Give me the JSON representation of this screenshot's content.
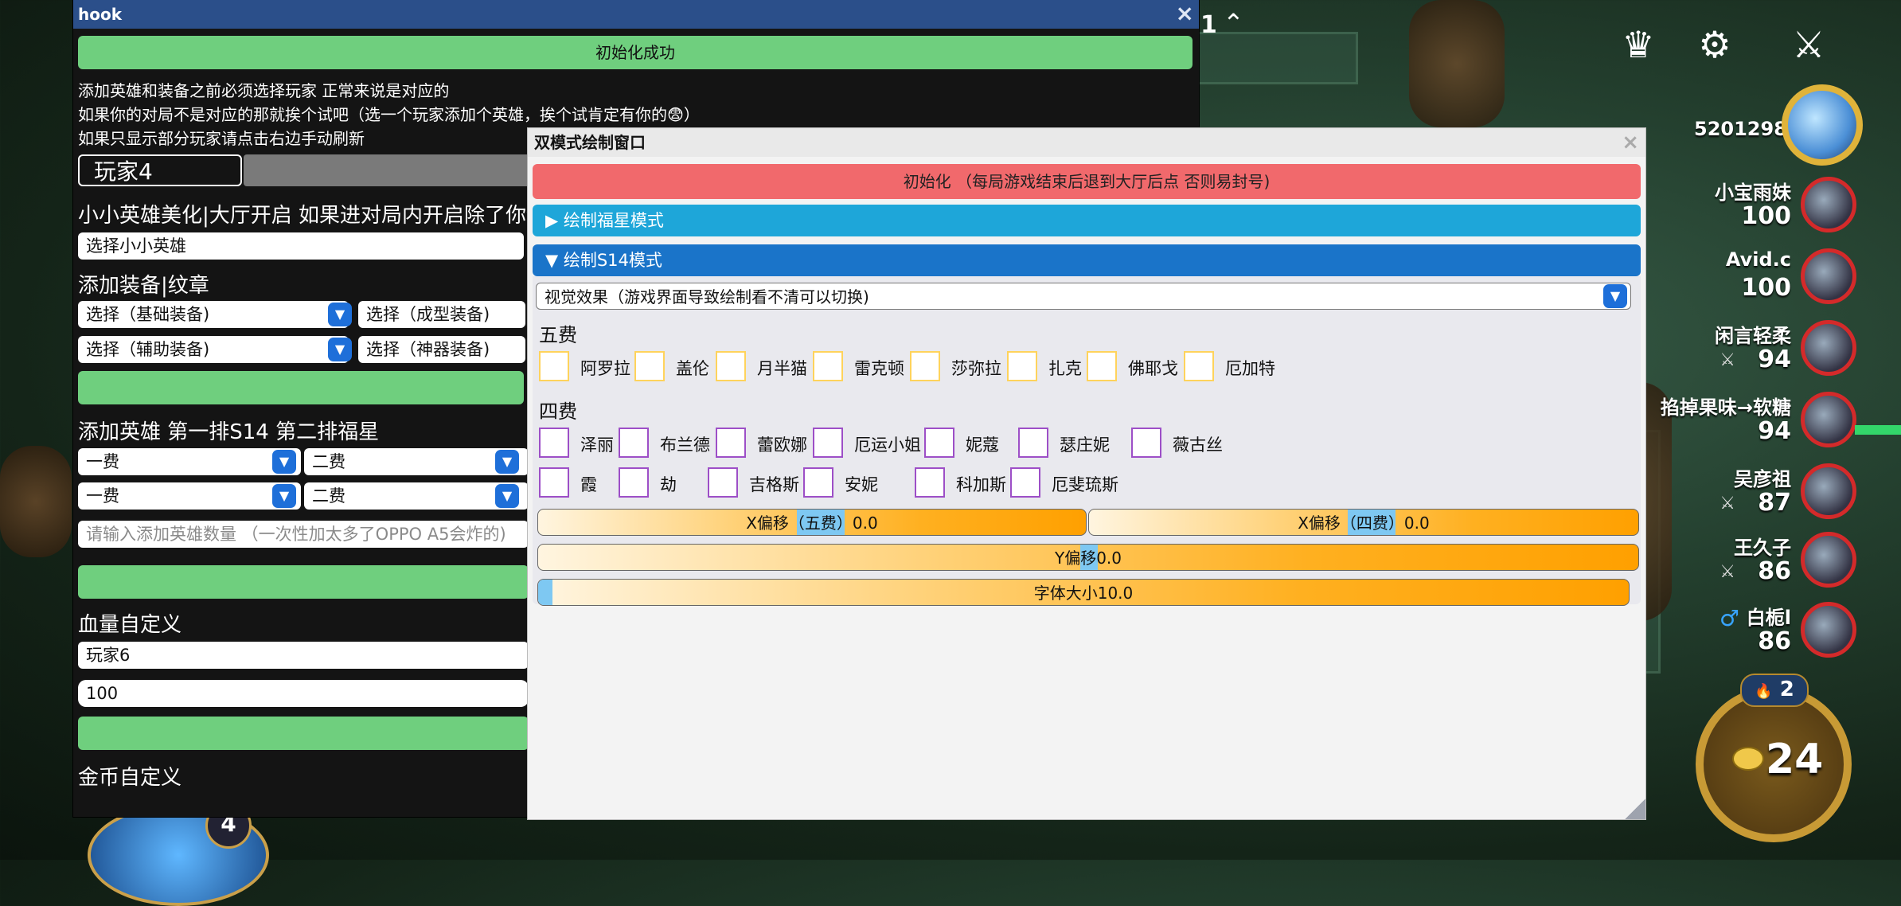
{
  "hook": {
    "title": "hook",
    "close": "×",
    "init_success": "初始化成功",
    "notes": [
      "添加英雄和装备之前必须选择玩家 正常来说是对应的",
      "如果你的对局不是对应的那就挨个试吧（选一个玩家添加个英雄，挨个试肯定有你的😨）",
      "如果只显示部分玩家请点击右边手动刷新"
    ],
    "player_tab": "玩家4",
    "little_legend_section": "小小英雄美化|大厅开启 如果进对局内开启除了你全",
    "little_legend_select": "选择小小英雄",
    "equip_section": "添加装备|纹章",
    "equip_selects": [
      "选择（基础装备)",
      "选择（成型装备)",
      "选择（辅助装备)",
      "选择（神器装备)"
    ],
    "hero_section": "添加英雄 第一排S14 第二排福星",
    "hero_selects": [
      "一费",
      "二费",
      "一费",
      "二费"
    ],
    "hero_count_placeholder": "请输入添加英雄数量 （一次性加太多了OPPO A5会炸的)",
    "hp_section": "血量自定义",
    "hp_player": "玩家6",
    "hp_value": "100",
    "gold_section": "金币自定义"
  },
  "dual": {
    "title": "双模式绘制窗口",
    "close": "×",
    "init_button": "初始化 （每局游戏结束后退到大厅后点 否则易封号)",
    "fuxing_header": "▶   绘制福星模式",
    "s14_header": "▼   绘制S14模式",
    "visual_effect": "视觉效果（游戏界面导致绘制看不清可以切换)",
    "tier5_label": "五费",
    "tier5": [
      "阿罗拉",
      "盖伦",
      "月半猫",
      "雷克顿",
      "莎弥拉",
      "扎克",
      "佛耶戈",
      "厄加特"
    ],
    "tier4_label": "四费",
    "tier4_row1": [
      "泽丽",
      "布兰德",
      "蕾欧娜",
      "厄运小姐",
      "妮蔻",
      "瑟庄妮",
      "薇古丝"
    ],
    "tier4_row2": [
      "霞",
      "劫",
      "吉格斯",
      "安妮",
      "科加斯",
      "厄斐琉斯"
    ],
    "x_offset5": "X偏移（五费）0.0",
    "x_offset4": "X偏移（四费）0.0",
    "y_offset": "Y偏移0.0",
    "font_size": "字体大小10.0"
  },
  "hud": {
    "partial_top": "1",
    "chevron": "^",
    "top_score": "5201298",
    "players": [
      {
        "name": "小宝雨妹",
        "hp": "100",
        "sword": false
      },
      {
        "name": "Avid.c",
        "hp": "100",
        "sword": false
      },
      {
        "name": "闲言轻柔",
        "hp": "94",
        "sword": true
      },
      {
        "name": "掐掉果味→软糖",
        "hp": "94",
        "sword": false
      },
      {
        "name": "吴彦祖",
        "hp": "87",
        "sword": true
      },
      {
        "name": "王久子",
        "hp": "86",
        "sword": true
      },
      {
        "name": "白栀l",
        "hp": "86",
        "sword": false
      }
    ],
    "gender_symbol": "♂",
    "level": "2",
    "level_icon": "🔥",
    "gold": "24",
    "bottom_level": "4",
    "colors": {
      "hook_title": "#2b4f8a",
      "green": "#6fcf7e",
      "red": "#f1696c",
      "blue_header": "#1a74c9",
      "health_ring": "#d42a2a"
    }
  }
}
